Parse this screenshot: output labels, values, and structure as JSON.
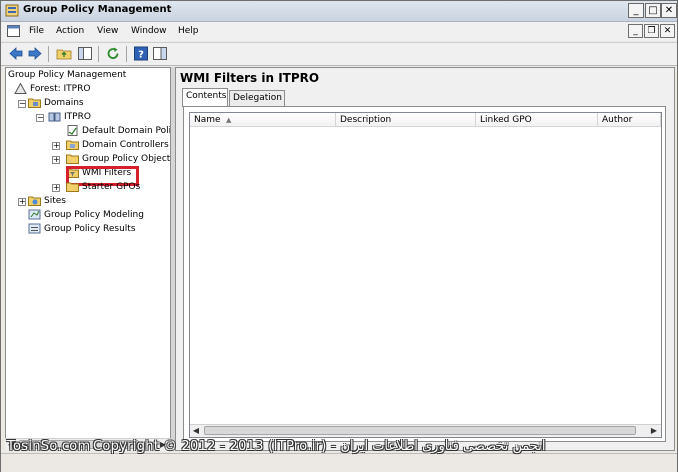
{
  "window": {
    "title": "Group Policy Management"
  },
  "menu": [
    "File",
    "Action",
    "View",
    "Window",
    "Help"
  ],
  "icons": {
    "app": "group-policy-icon",
    "back": "arrow-left-icon",
    "forward": "arrow-right-icon",
    "up": "folder-up-icon",
    "show_hide": "show-hide-tree-icon",
    "refresh": "refresh-icon",
    "help": "help-icon",
    "console": "console-icon"
  },
  "tree": {
    "root": "Group Policy Management",
    "forest": "Forest: ITPRO",
    "domains": "Domains",
    "domain": "ITPRO",
    "default_policy": "Default Domain Polic",
    "domain_controllers": "Domain Controllers",
    "gpo_objects": "Group Policy Objects",
    "wmi_filters": "WMI Filters",
    "starter_gpos": "Starter GPOs",
    "sites": "Sites",
    "modeling": "Group Policy Modeling",
    "results": "Group Policy Results"
  },
  "right": {
    "title": "WMI Filters in ITPRO",
    "tabs": [
      "Contents",
      "Delegation"
    ],
    "columns": [
      "Name",
      "Description",
      "Linked GPO",
      "Author"
    ]
  },
  "watermark": {
    "left": "TosinSo.com",
    "center": "Copyright © 2012 - 2013 (ITPro.ir) - انجمن تخصصی فناوری اطلاعات ایران"
  },
  "colors": {
    "highlight": "#d3202a"
  }
}
